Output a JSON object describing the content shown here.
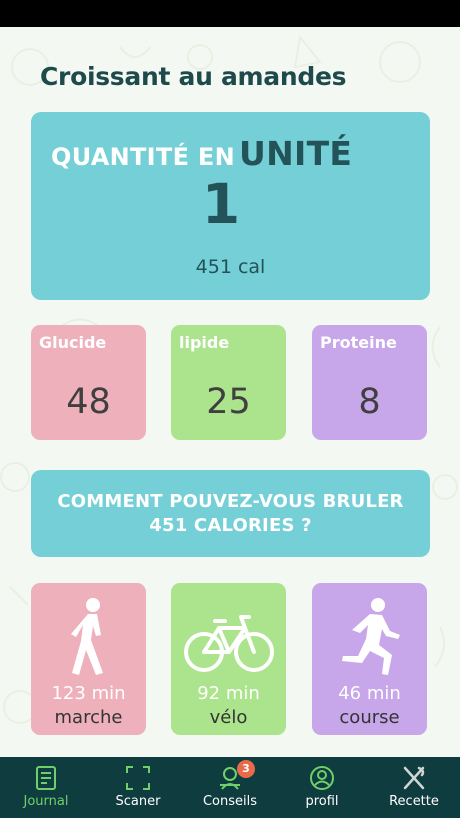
{
  "header": {
    "title": "Croissant au amandes"
  },
  "quantity": {
    "label_prefix": "QUANTITÉ EN",
    "label_unit": "UNITÉ",
    "value": "1",
    "calories": "451 cal"
  },
  "macros": [
    {
      "label": "Glucide",
      "value": "48",
      "color": "#eeb1bc"
    },
    {
      "label": "lipide",
      "value": "25",
      "color": "#abe48c"
    },
    {
      "label": "Proteine",
      "value": "8",
      "color": "#c7a7ea"
    }
  ],
  "burn": {
    "question": "COMMENT POUVEZ-VOUS BRULER 451 CALORIES ?"
  },
  "activities": [
    {
      "icon": "walking-icon",
      "minutes": "123 min",
      "name": "marche",
      "color": "#eeb1bc"
    },
    {
      "icon": "bicycle-icon",
      "minutes": "92 min",
      "name": "vélo",
      "color": "#abe48c"
    },
    {
      "icon": "running-icon",
      "minutes": "46 min",
      "name": "course",
      "color": "#c7a7ea"
    }
  ],
  "tabbar": {
    "accent": "#6fd06a",
    "background": "#0f3d3f",
    "tabs": [
      {
        "label": "Journal",
        "icon": "journal-icon",
        "active": true
      },
      {
        "label": "Scaner",
        "icon": "scan-icon",
        "active": false
      },
      {
        "label": "Conseils",
        "icon": "advice-icon",
        "active": false,
        "badge": "3"
      },
      {
        "label": "profil",
        "icon": "profile-icon",
        "active": false
      },
      {
        "label": "Recette",
        "icon": "utensils-icon",
        "active": false
      }
    ]
  }
}
